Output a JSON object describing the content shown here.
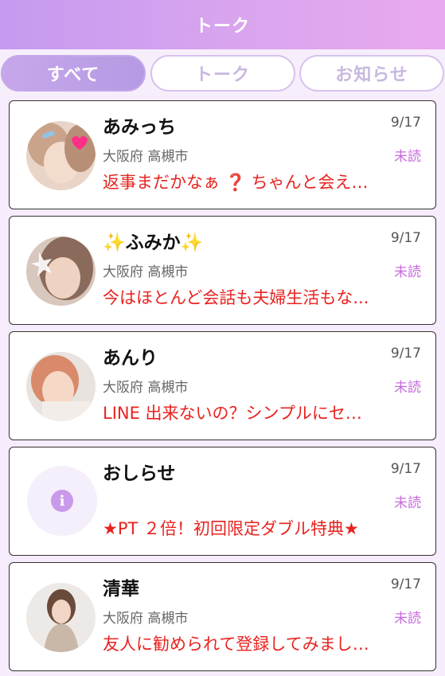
{
  "header": {
    "title": "トーク"
  },
  "tabs": [
    {
      "label": "すべて",
      "active": true
    },
    {
      "label": "トーク",
      "active": false
    },
    {
      "label": "お知らせ",
      "active": false
    }
  ],
  "messages": [
    {
      "name": "あみっち",
      "date": "9/17",
      "location": "大阪府 高槻市",
      "status": "未読",
      "preview": "返事まだかなぁ ❓ ちゃんと会え…",
      "avatar_icon": "user-photo-icon"
    },
    {
      "name_prefix": "✨",
      "name": "ふみか",
      "name_suffix": "✨",
      "date": "9/17",
      "location": "大阪府 高槻市",
      "status": "未読",
      "preview": "今はほとんど会話も夫婦生活もな...",
      "avatar_icon": "user-photo-icon"
    },
    {
      "name": "あんり",
      "date": "9/17",
      "location": "大阪府 高槻市",
      "status": "未読",
      "preview": "LINE 出来ないの？シンプルにセ…",
      "avatar_icon": "user-photo-icon"
    },
    {
      "name": "おしらせ",
      "date": "9/17",
      "location": "",
      "status": "未読",
      "preview": "★PT ２倍！初回限定ダブル特典★",
      "avatar_icon": "info-icon",
      "icon_glyph": "i"
    },
    {
      "name": "清華",
      "date": "9/17",
      "location": "大阪府 高槻市",
      "status": "未読",
      "preview": "友人に勧められて登録してみまし…",
      "avatar_icon": "user-photo-icon"
    }
  ],
  "colors": {
    "header_gradient_start": "#c59af0",
    "header_gradient_end": "#e9a8ef",
    "preview_text": "#e8231f",
    "status_text": "#c86be0",
    "tab_active": "#b59ae3"
  }
}
